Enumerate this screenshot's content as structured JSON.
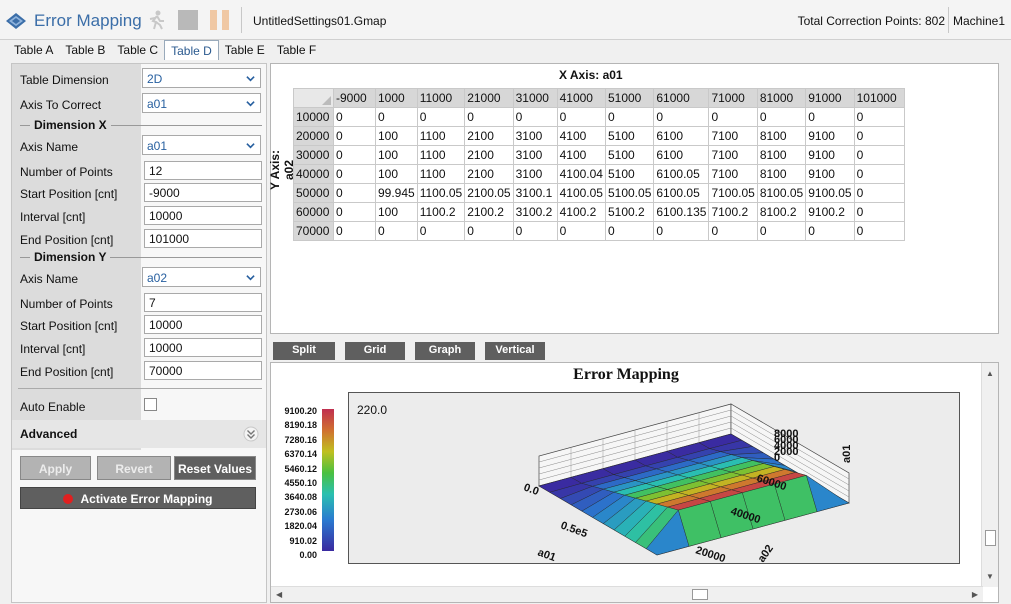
{
  "header": {
    "app_title": "Error Mapping",
    "file_name": "UntitledSettings01.Gmap",
    "total_points": "Total Correction Points: 802",
    "machine": "Machine1"
  },
  "tabs": [
    "Table A",
    "Table B",
    "Table C",
    "Table D",
    "Table E",
    "Table F"
  ],
  "active_tab": "Table D",
  "settings": {
    "table_dimension": {
      "label": "Table Dimension",
      "value": "2D"
    },
    "axis_to_correct": {
      "label": "Axis To Correct",
      "value": "a01"
    },
    "dim_x": {
      "title": "Dimension X",
      "axis_name": {
        "label": "Axis Name",
        "value": "a01"
      },
      "num_points": {
        "label": "Number of Points",
        "value": "12"
      },
      "start": {
        "label": "Start Position [cnt]",
        "value": "-9000"
      },
      "interval": {
        "label": "Interval [cnt]",
        "value": "10000"
      },
      "end": {
        "label": "End Position [cnt]",
        "value": "101000"
      }
    },
    "dim_y": {
      "title": "Dimension Y",
      "axis_name": {
        "label": "Axis Name",
        "value": "a02"
      },
      "num_points": {
        "label": "Number of Points",
        "value": "7"
      },
      "start": {
        "label": "Start Position [cnt]",
        "value": "10000"
      },
      "interval": {
        "label": "Interval [cnt]",
        "value": "10000"
      },
      "end": {
        "label": "End Position [cnt]",
        "value": "70000"
      }
    },
    "auto_enable": {
      "label": "Auto Enable",
      "checked": false
    },
    "advanced": "Advanced"
  },
  "buttons": {
    "apply": "Apply",
    "revert": "Revert",
    "reset": "Reset Values",
    "activate": "Activate Error Mapping"
  },
  "table": {
    "x_axis_title": "X Axis: a01",
    "y_axis_title": "Y Axis: a02",
    "x_headers": [
      "-9000",
      "1000",
      "11000",
      "21000",
      "31000",
      "41000",
      "51000",
      "61000",
      "71000",
      "81000",
      "91000",
      "101000"
    ],
    "rows": [
      {
        "y": "10000",
        "cells": [
          "0",
          "0",
          "0",
          "0",
          "0",
          "0",
          "0",
          "0",
          "0",
          "0",
          "0",
          "0"
        ]
      },
      {
        "y": "20000",
        "cells": [
          "0",
          "100",
          "1100",
          "2100",
          "3100",
          "4100",
          "5100",
          "6100",
          "7100",
          "8100",
          "9100",
          "0"
        ]
      },
      {
        "y": "30000",
        "cells": [
          "0",
          "100",
          "1100",
          "2100",
          "3100",
          "4100",
          "5100",
          "6100",
          "7100",
          "8100",
          "9100",
          "0"
        ]
      },
      {
        "y": "40000",
        "cells": [
          "0",
          "100",
          "1100",
          "2100",
          "3100",
          "4100.04",
          "5100",
          "6100.05",
          "7100",
          "8100",
          "9100",
          "0"
        ]
      },
      {
        "y": "50000",
        "cells": [
          "0",
          "99.945",
          "1100.05",
          "2100.05",
          "3100.1",
          "4100.05",
          "5100.05",
          "6100.05",
          "7100.05",
          "8100.05",
          "9100.05",
          "0"
        ]
      },
      {
        "y": "60000",
        "cells": [
          "0",
          "100",
          "1100.2",
          "2100.2",
          "3100.2",
          "4100.2",
          "5100.2",
          "6100.135",
          "7100.2",
          "8100.2",
          "9100.2",
          "0"
        ]
      },
      {
        "y": "70000",
        "cells": [
          "0",
          "0",
          "0",
          "0",
          "0",
          "0",
          "0",
          "0",
          "0",
          "0",
          "0",
          "0"
        ]
      }
    ]
  },
  "chart_buttons": [
    "Split",
    "Grid",
    "Graph",
    "Vertical"
  ],
  "chart": {
    "title": "Error Mapping",
    "corner_value": "220.0",
    "colorbar_ticks": [
      "9100.20",
      "8190.18",
      "7280.16",
      "6370.14",
      "5460.12",
      "4550.10",
      "3640.08",
      "2730.06",
      "1820.04",
      "910.02",
      "0.00"
    ],
    "x_axis_label": "a01",
    "x_ticks": [
      "0.0",
      "0.5e5"
    ],
    "y_axis_label": "a02",
    "y_ticks": [
      "20000",
      "40000",
      "60000"
    ],
    "z_axis_label": "a01",
    "z_ticks": [
      "8000",
      "6000",
      "4000",
      "2000",
      "0"
    ]
  },
  "chart_data": {
    "type": "surface",
    "title": "Error Mapping",
    "x_label": "a01",
    "y_label": "a02",
    "z_label": "a01",
    "x": [
      -9000,
      1000,
      11000,
      21000,
      31000,
      41000,
      51000,
      61000,
      71000,
      81000,
      91000,
      101000
    ],
    "y": [
      10000,
      20000,
      30000,
      40000,
      50000,
      60000,
      70000
    ],
    "z": [
      [
        0,
        0,
        0,
        0,
        0,
        0,
        0,
        0,
        0,
        0,
        0,
        0
      ],
      [
        0,
        100,
        1100,
        2100,
        3100,
        4100,
        5100,
        6100,
        7100,
        8100,
        9100,
        0
      ],
      [
        0,
        100,
        1100,
        2100,
        3100,
        4100,
        5100,
        6100,
        7100,
        8100,
        9100,
        0
      ],
      [
        0,
        100,
        1100,
        2100,
        3100,
        4100.04,
        5100,
        6100.05,
        7100,
        8100,
        9100,
        0
      ],
      [
        0,
        99.945,
        1100.05,
        2100.05,
        3100.1,
        4100.05,
        5100.05,
        6100.05,
        7100.05,
        8100.05,
        9100.05,
        0
      ],
      [
        0,
        100,
        1100.2,
        2100.2,
        3100.2,
        4100.2,
        5100.2,
        6100.135,
        7100.2,
        8100.2,
        9100.2,
        0
      ],
      [
        0,
        0,
        0,
        0,
        0,
        0,
        0,
        0,
        0,
        0,
        0,
        0
      ]
    ],
    "color_range": [
      0.0,
      9100.2
    ]
  },
  "colors": {
    "accent": "#3b6ea8",
    "button_dark": "#5f5f5f",
    "activate_dot": "#e02020"
  }
}
